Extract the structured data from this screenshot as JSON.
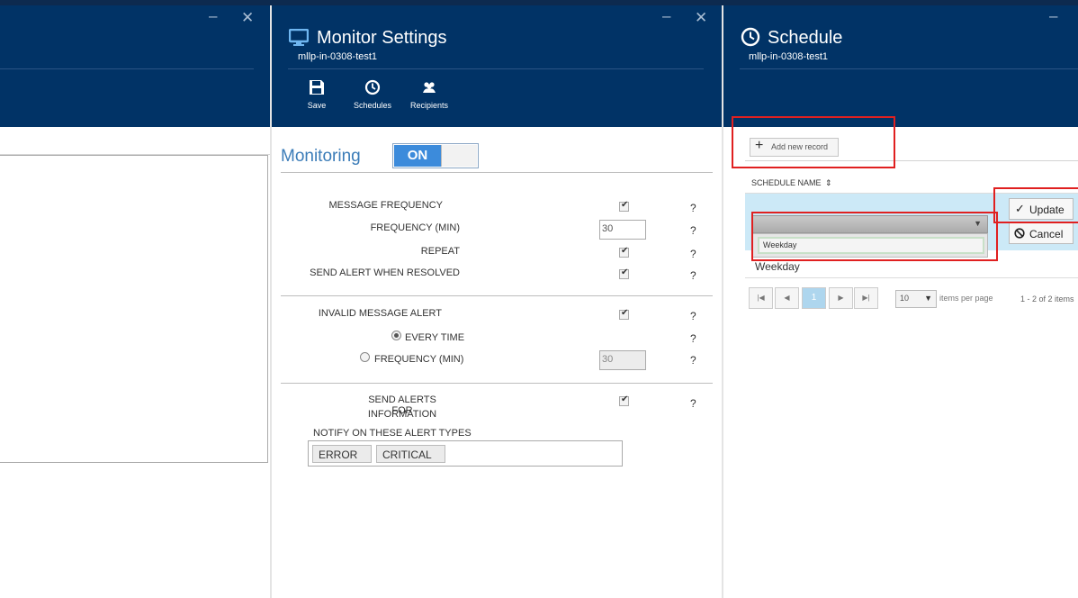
{
  "monitor": {
    "title": "Monitor Settings",
    "subtitle": "mllp-in-0308-test1",
    "toolbar": {
      "save": "Save",
      "schedules": "Schedules",
      "recipients": "Recipients"
    },
    "monitoring_label": "Monitoring",
    "toggle_on": "ON",
    "rows": {
      "message_frequency": "MESSAGE FREQUENCY",
      "frequency_min": "FREQUENCY (MIN)",
      "frequency_value": "30",
      "repeat": "REPEAT",
      "send_alert_resolved": "SEND ALERT WHEN RESOLVED",
      "invalid_message_alert": "INVALID MESSAGE ALERT",
      "every_time": "EVERY TIME",
      "frequency_min_2": "FREQUENCY (MIN)",
      "frequency_value_2": "30",
      "send_alerts_for": "SEND ALERTS FOR",
      "information": "INFORMATION",
      "notify_label": "NOTIFY ON THESE ALERT TYPES"
    },
    "alert_types": [
      "ERROR",
      "CRITICAL"
    ],
    "help": "?"
  },
  "schedule": {
    "title": "Schedule",
    "subtitle": "mllp-in-0308-test1",
    "add_record": "Add new record",
    "column_header": "SCHEDULE NAME",
    "edit_value": "Weekday",
    "update": "Update",
    "cancel": "Cancel",
    "row_value": "Weekday",
    "pager": {
      "page": "1",
      "page_size": "10",
      "items_per_page": "items per page",
      "summary": "1 - 2 of 2 items"
    }
  },
  "colors": {
    "header": "#013366",
    "toggle_on": "#3c8bdb",
    "highlight": "#cce9f7",
    "annotation": "#e02020"
  },
  "icons": [
    "monitor-icon",
    "save-icon",
    "clock-icon",
    "people-icon",
    "plus-icon",
    "check-icon",
    "cancel-icon",
    "chevron-down-icon",
    "sort-icon",
    "first-page-icon",
    "prev-page-icon",
    "next-page-icon",
    "last-page-icon"
  ]
}
